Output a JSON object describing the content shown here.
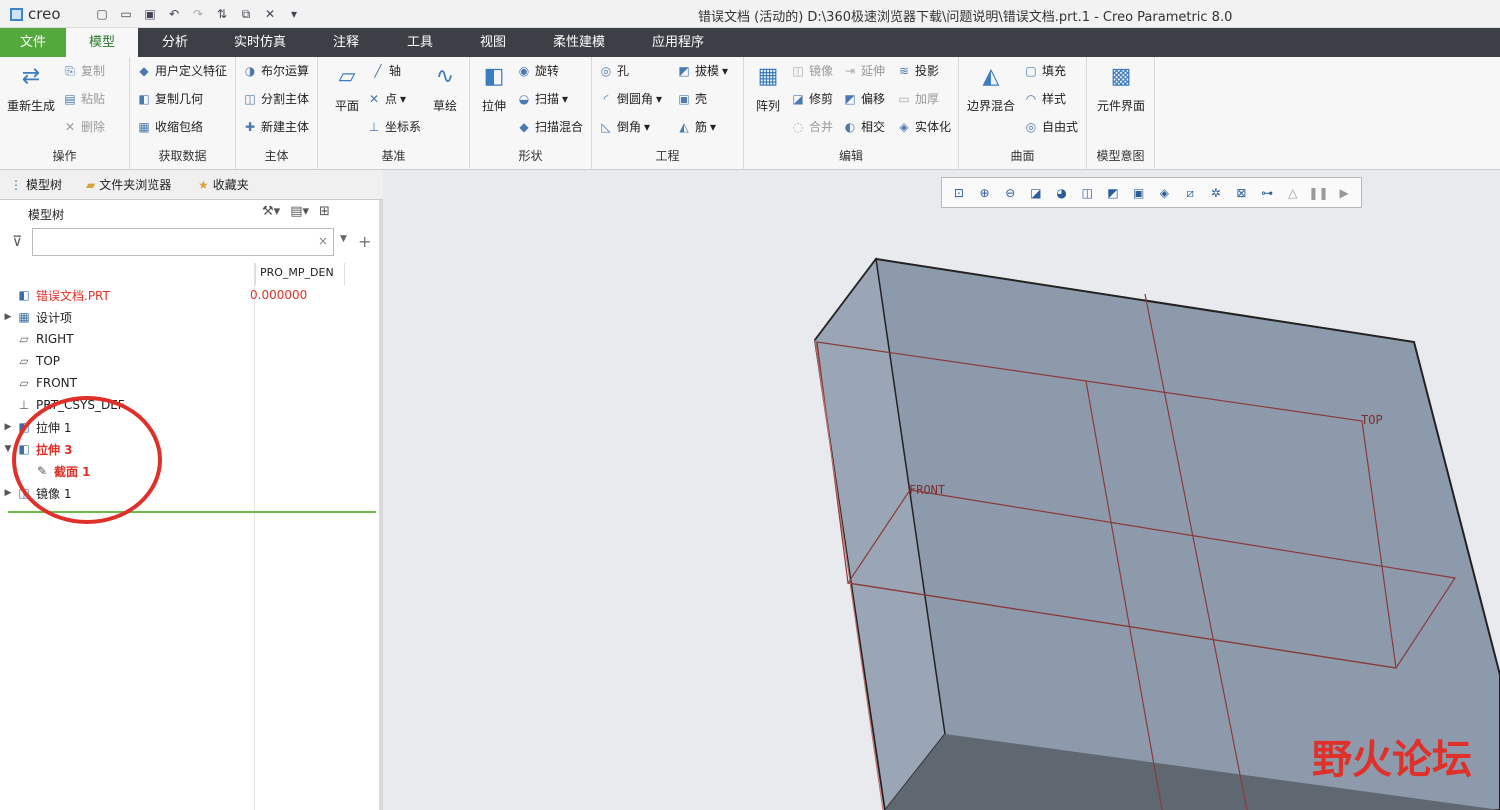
{
  "app": {
    "logo": "creo",
    "title": "错误文档 (活动的) D:\\360极速浏览器下载\\问题说明\\错误文档.prt.1 - Creo Parametric 8.0"
  },
  "quick_access": [
    "new-icon",
    "open-icon",
    "save-icon",
    "undo-icon",
    "redo-icon",
    "regenerate-icon",
    "windows-icon",
    "close-icon",
    "customize-icon"
  ],
  "menus": [
    "文件",
    "模型",
    "分析",
    "实时仿真",
    "注释",
    "工具",
    "视图",
    "柔性建模",
    "应用程序"
  ],
  "ribbon": {
    "operations": {
      "regen": "重新生成",
      "copy": "复制",
      "paste": "粘贴",
      "delete": "删除",
      "label": "操作"
    },
    "get_data": {
      "udf": "用户定义特征",
      "copy_geom": "复制几何",
      "shrinkwrap": "收缩包络",
      "label": "获取数据"
    },
    "body": {
      "boolean": "布尔运算",
      "split": "分割主体",
      "new": "新建主体",
      "label": "主体"
    },
    "datum": {
      "plane": "平面",
      "axis": "轴",
      "point": "点",
      "csys": "坐标系",
      "sketch": "草绘",
      "label": "基准"
    },
    "shapes": {
      "extrude": "拉伸",
      "revolve": "旋转",
      "sweep": "扫描",
      "swept_blend": "扫描混合",
      "label": "形状"
    },
    "engineering": {
      "hole": "孔",
      "round": "倒圆角",
      "chamfer": "倒角",
      "draft": "拔模",
      "shell": "壳",
      "rib": "筋",
      "label": "工程"
    },
    "editing": {
      "pattern": "阵列",
      "mirror": "镜像",
      "trim": "修剪",
      "merge": "合并",
      "extend": "延伸",
      "offset": "偏移",
      "intersect": "相交",
      "project": "投影",
      "thicken": "加厚",
      "solidify": "实体化",
      "label": "编辑"
    },
    "surfaces": {
      "boundary": "边界混合",
      "fill": "填充",
      "style": "样式",
      "freestyle": "自由式",
      "label": "曲面"
    },
    "intent": {
      "component": "元件界面",
      "label": "模型意图"
    }
  },
  "panel": {
    "tabs": [
      "模型树",
      "文件夹浏览器",
      "收藏夹"
    ],
    "tree_header": "模型树",
    "column": "PRO_MP_DEN",
    "filter_placeholder": "",
    "rows": [
      {
        "label": "错误文档.PRT",
        "value": "0.000000"
      },
      {
        "label": "设计项"
      },
      {
        "label": "RIGHT"
      },
      {
        "label": "TOP"
      },
      {
        "label": "FRONT"
      },
      {
        "label": "PRT_CSYS_DEF"
      },
      {
        "label": "拉伸 1"
      },
      {
        "label": "拉伸 3"
      },
      {
        "label": "截面 1"
      },
      {
        "label": "镜像 1"
      }
    ]
  },
  "viewport": {
    "datum_top": "TOP",
    "datum_front": "FRONT"
  },
  "watermark": "野火论坛",
  "colors": {
    "accent": "#54a93c",
    "menubar": "#3c3f45",
    "error": "#e0302a",
    "model_face": "#8d9aab",
    "annotation": "#e0302a"
  }
}
